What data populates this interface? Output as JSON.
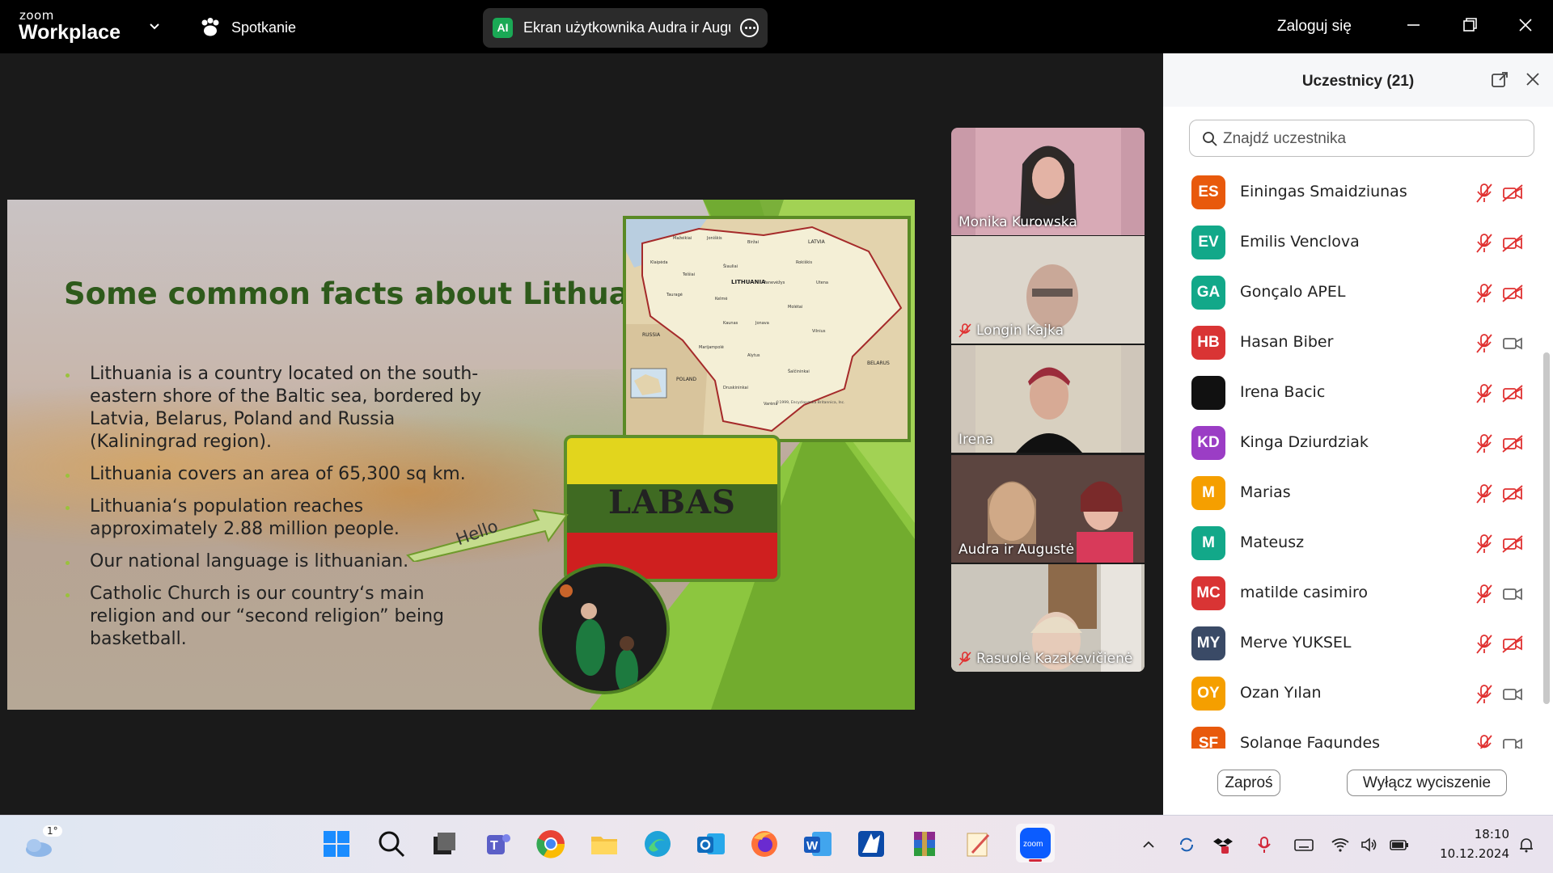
{
  "app": {
    "logo_small": "zoom",
    "logo_big": "Workplace",
    "meeting_label": "Spotkanie",
    "share_avatar": "AI",
    "share_text": "Ekran użytkownika Audra ir Augu",
    "login_label": "Zaloguj się"
  },
  "slide": {
    "title": "Some common facts about Lithuania",
    "bullets": [
      "Lithuania is a country located on the south-eastern shore of the Baltic sea, bordered by Latvia, Belarus, Poland and Russia (Kaliningrad region).",
      "Lithuania covers an area of 65,300 sq km.",
      "Lithuania‘s population reaches approximately 2.88 million people.",
      "Our national language is lithuanian.",
      "Catholic Church is our country‘s main religion and our “second religion” being basketball."
    ],
    "flag_text": "LABAS",
    "hello_text": "Hello",
    "map_labels": {
      "country": "LITHUANIA",
      "latvia": "LATVIA",
      "russia": "RUSSIA",
      "poland": "POLAND",
      "belarus": "BELARUS",
      "credit": "©1999, Encyclopædia Britannica, Inc."
    },
    "colors": {
      "title": "#2e5a1b",
      "accent_green": "#8cc63f",
      "frame_green": "#5a8a25"
    }
  },
  "gallery": [
    {
      "name": "Monika Kurowska",
      "muted": false,
      "active": false
    },
    {
      "name": "Longin Kajka",
      "muted": true,
      "active": false
    },
    {
      "name": "Irena",
      "muted": false,
      "active": false
    },
    {
      "name": "Audra ir Augustė",
      "muted": false,
      "active": true
    },
    {
      "name": "Rasuolė Kazakevičienė",
      "muted": true,
      "active": false
    }
  ],
  "panel": {
    "title": "Uczestnicy (21)",
    "search_placeholder": "Znajdź uczestnika",
    "participants": [
      {
        "initials": "ES",
        "name": "Einingas Smaidziunas",
        "color": "#e8590c",
        "cam_off": true
      },
      {
        "initials": "EV",
        "name": "Emilis Venclova",
        "color": "#12a889",
        "cam_off": true
      },
      {
        "initials": "GA",
        "name": "Gonçalo APEL",
        "color": "#12a889",
        "cam_off": true
      },
      {
        "initials": "HB",
        "name": "Hasan Biber",
        "color": "#d93434",
        "cam_off": false
      },
      {
        "initials": "",
        "name": "Irena Bacic",
        "color": "#111111",
        "cam_off": true
      },
      {
        "initials": "KD",
        "name": "Kinga Dziurdziak",
        "color": "#9b3dc5",
        "cam_off": true
      },
      {
        "initials": "M",
        "name": "Marias",
        "color": "#f59f00",
        "cam_off": true
      },
      {
        "initials": "M",
        "name": "Mateusz",
        "color": "#12a889",
        "cam_off": true
      },
      {
        "initials": "MC",
        "name": "matilde casimiro",
        "color": "#d93434",
        "cam_off": false
      },
      {
        "initials": "MY",
        "name": "Merve YUKSEL",
        "color": "#3a4a66",
        "cam_off": true
      },
      {
        "initials": "OY",
        "name": "Ozan Yılan",
        "color": "#f59f00",
        "cam_off": false
      },
      {
        "initials": "SF",
        "name": "Solange Fagundes",
        "color": "#e8590c",
        "cam_off": false
      }
    ],
    "invite_label": "Zaproś",
    "unmute_all_label": "Wyłącz wyciszenie",
    "muted_icon_color": "#e03131"
  },
  "taskbar": {
    "weather_temp": "1°",
    "time": "18:10",
    "date": "10.12.2024",
    "apps": [
      "start-icon",
      "search-icon",
      "task-view-icon",
      "teams-icon",
      "chrome-icon",
      "file-explorer-icon",
      "edge-icon",
      "outlook-icon",
      "firefox-icon",
      "word-icon",
      "app-icon",
      "winrar-icon",
      "notepad-icon",
      "zoom-icon"
    ]
  }
}
